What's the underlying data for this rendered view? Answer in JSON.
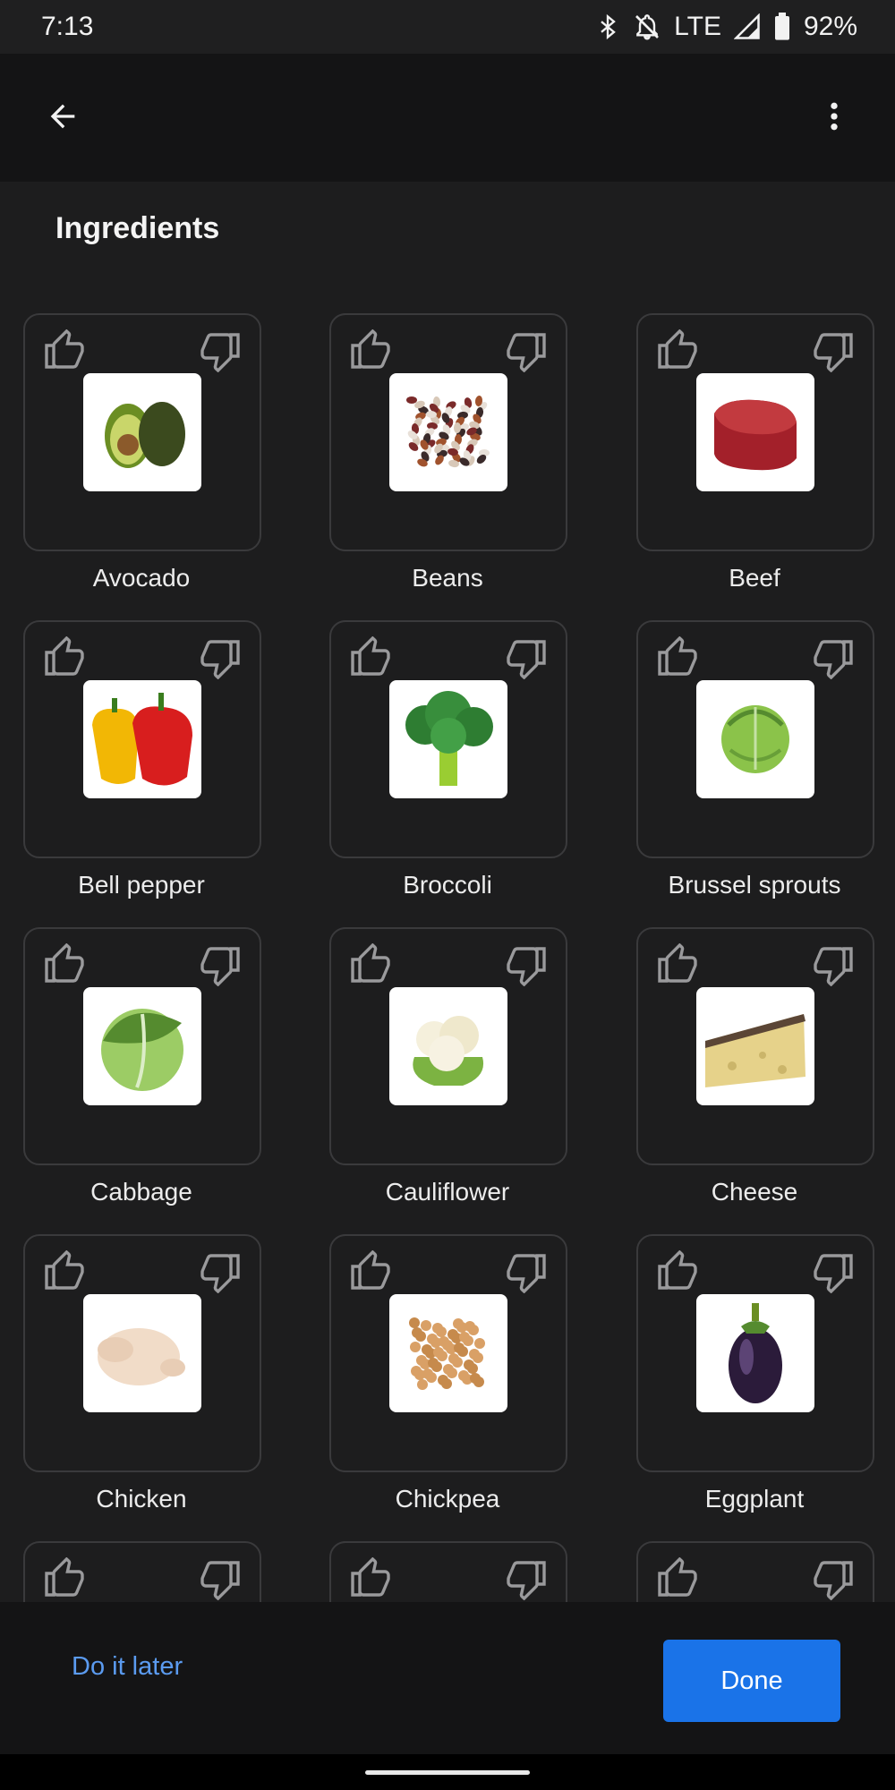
{
  "status_bar": {
    "time": "7:13",
    "network": "LTE",
    "battery": "92%"
  },
  "app_bar": {
    "back_icon": "arrow-back-icon",
    "menu_icon": "more-vert-icon"
  },
  "section": {
    "title": "Ingredients"
  },
  "ingredients": [
    {
      "label": "Avocado"
    },
    {
      "label": "Beans"
    },
    {
      "label": "Beef"
    },
    {
      "label": "Bell pepper"
    },
    {
      "label": "Broccoli"
    },
    {
      "label": "Brussel sprouts"
    },
    {
      "label": "Cabbage"
    },
    {
      "label": "Cauliflower"
    },
    {
      "label": "Cheese"
    },
    {
      "label": "Chicken"
    },
    {
      "label": "Chickpea"
    },
    {
      "label": "Eggplant"
    },
    {
      "label": ""
    },
    {
      "label": ""
    },
    {
      "label": ""
    }
  ],
  "actions": {
    "later": "Do it later",
    "done": "Done"
  },
  "colors": {
    "accent": "#1a73e8",
    "link": "#5b9bf0",
    "background": "#1d1d1e",
    "card_border": "#3a3a3c"
  }
}
